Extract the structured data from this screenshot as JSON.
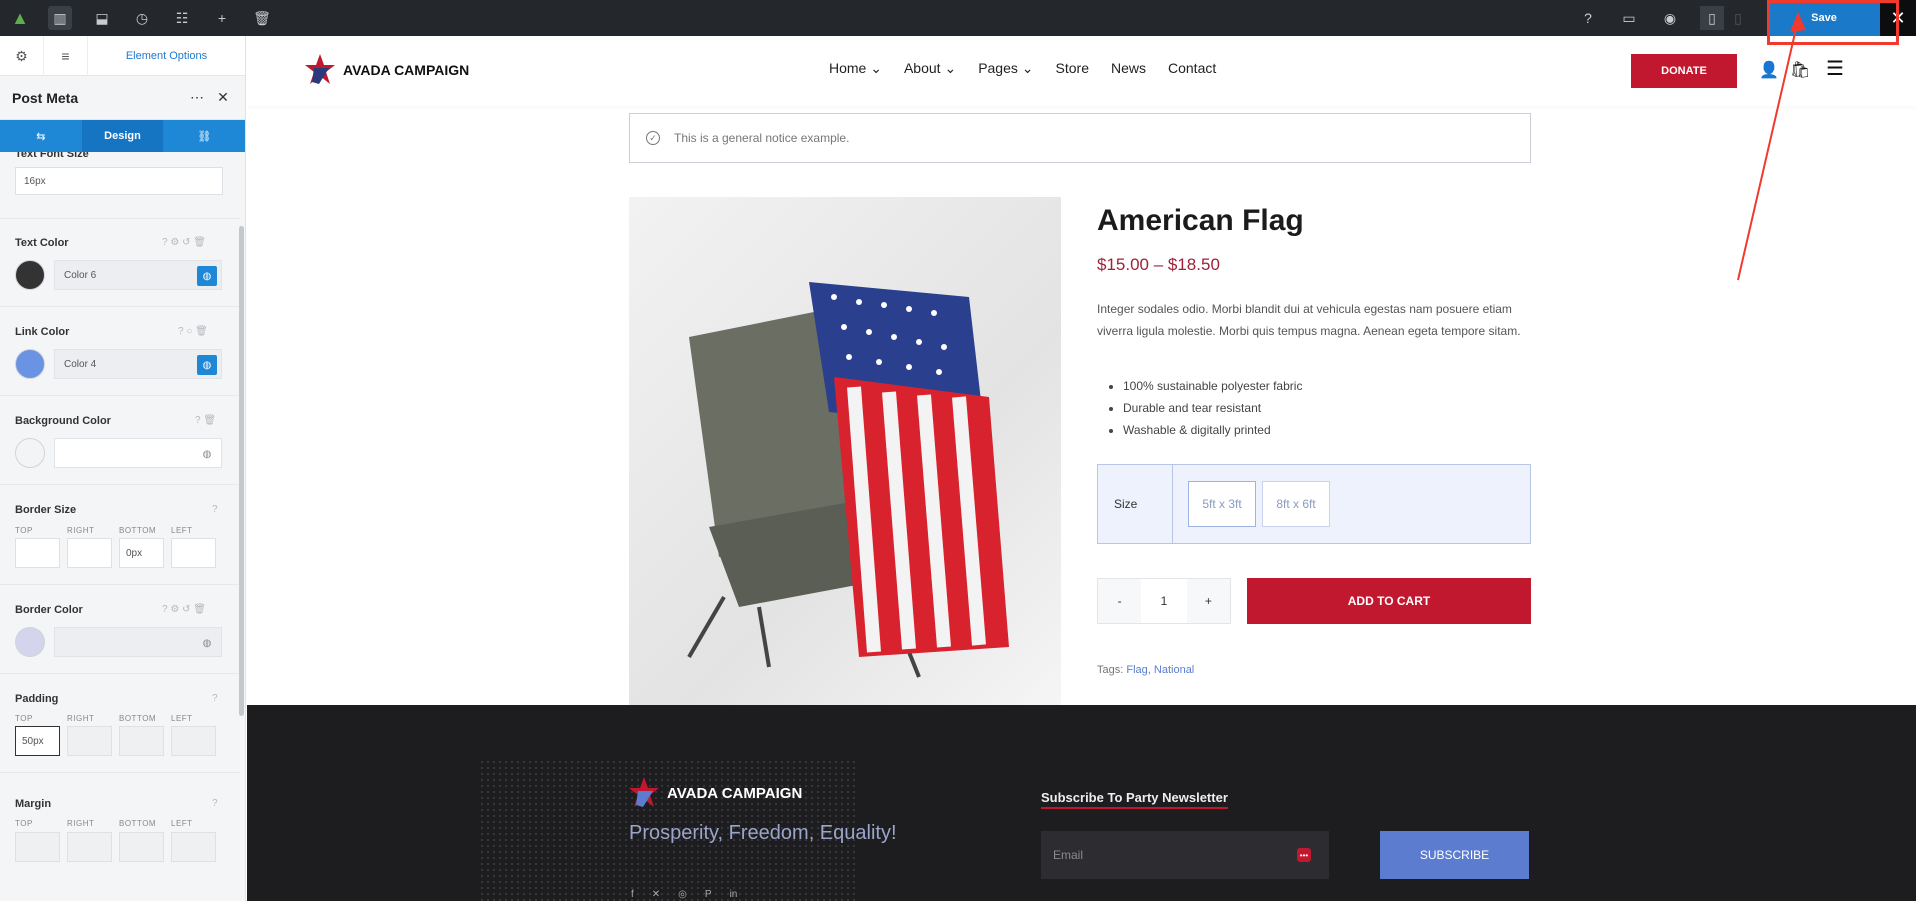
{
  "builder": {
    "save_label": "Save",
    "panel_title": "Element Options",
    "element_title": "Post Meta",
    "subtabs": [
      "Design"
    ]
  },
  "options": {
    "text_font_size": {
      "label": "Text Font Size",
      "value": "16px"
    },
    "text_color": {
      "label": "Text Color",
      "value": "Color 6",
      "swatch": "#333333"
    },
    "link_color": {
      "label": "Link Color",
      "value": "Color 4",
      "swatch": "#6b93e3"
    },
    "background_color": {
      "label": "Background Color",
      "swatch": "#f3f4f6"
    },
    "border_size": {
      "label": "Border Size",
      "top": "TOP",
      "right": "RIGHT",
      "bottom": "BOTTOM",
      "left": "LEFT",
      "bottom_value": "0px"
    },
    "border_color": {
      "label": "Border Color",
      "swatch": "#d4d4ec"
    },
    "padding": {
      "label": "Padding",
      "top": "TOP",
      "right": "RIGHT",
      "bottom": "BOTTOM",
      "left": "LEFT",
      "top_value": "50px"
    },
    "margin": {
      "label": "Margin",
      "top": "TOP",
      "right": "RIGHT",
      "bottom": "BOTTOM",
      "left": "LEFT"
    }
  },
  "site": {
    "logo_text": "AVADA CAMPAIGN",
    "nav": [
      "Home ⌄",
      "About ⌄",
      "Pages ⌄",
      "Store",
      "News",
      "Contact"
    ],
    "donate": "DONATE",
    "notice": "This is a general notice example.",
    "product": {
      "title": "American Flag",
      "price": "$15.00 – $18.50",
      "description": "Integer sodales odio. Morbi blandit dui at vehicula egestas nam posuere etiam viverra ligula molestie. Morbi quis tempus magna. Aenean egeta tempore sitam.",
      "features": [
        "100% sustainable polyester fabric",
        "Durable and tear resistant",
        "Washable & digitally printed"
      ],
      "size_label": "Size",
      "sizes": [
        "5ft x 3ft",
        "8ft x 6ft"
      ],
      "qty_minus": "-",
      "qty": "1",
      "qty_plus": "+",
      "add_to_cart": "ADD TO CART",
      "tags_label": "Tags:",
      "tags": [
        "Flag",
        "National"
      ]
    },
    "footer": {
      "logo_text": "AVADA CAMPAIGN",
      "tagline": "Prosperity, Freedom, Equality!",
      "newsletter_title": "Subscribe To Party Newsletter",
      "email_placeholder": "Email",
      "subscribe": "SUBSCRIBE"
    }
  },
  "colors": {
    "accent": "#1e88d6",
    "brand_red": "#c1172f",
    "link_blue": "#5b7ccf"
  }
}
